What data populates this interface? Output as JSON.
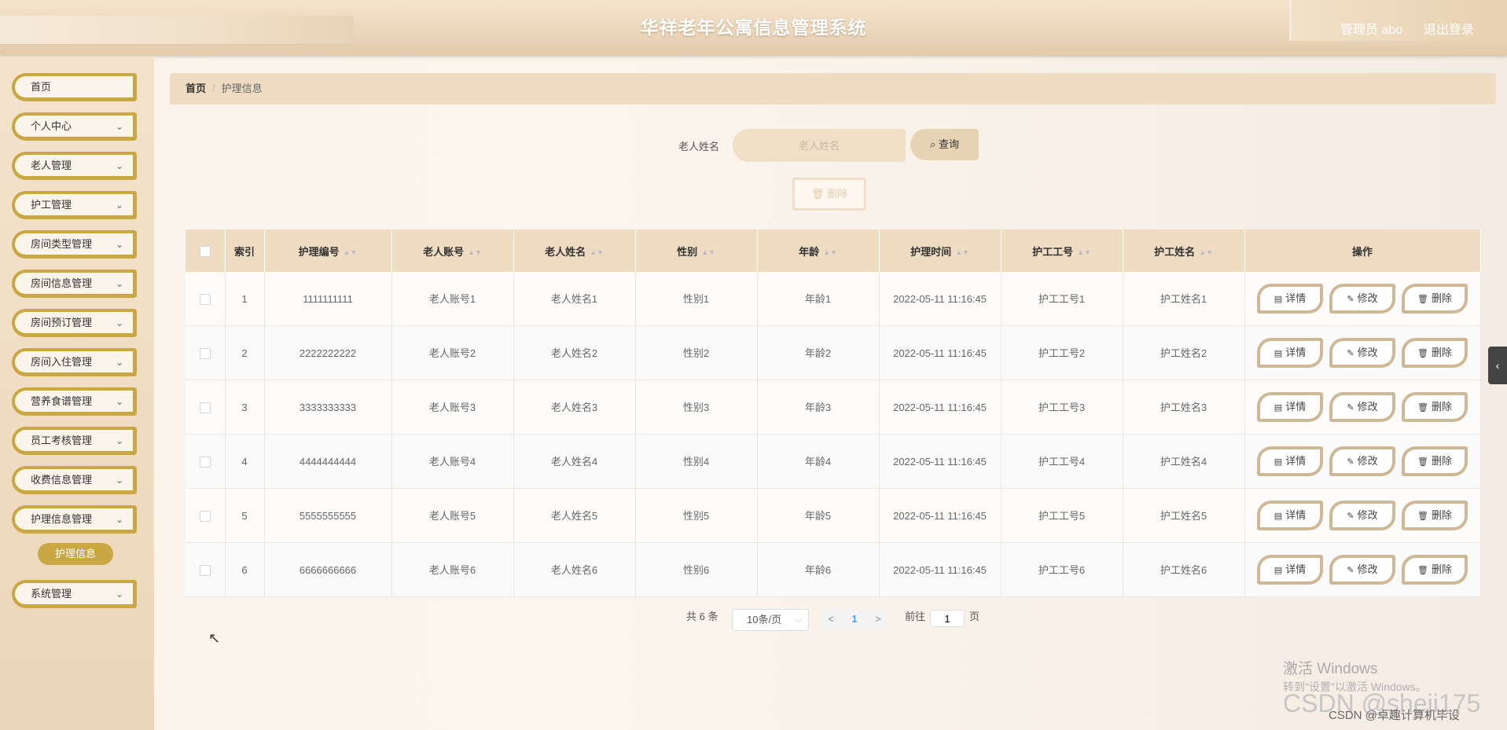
{
  "header": {
    "title": "华祥老年公寓信息管理系统",
    "user": "管理员 abo",
    "logout": "退出登录"
  },
  "sidebar": {
    "items": [
      {
        "label": "首页",
        "chevron": ""
      },
      {
        "label": "个人中心",
        "chevron": "⌄"
      },
      {
        "label": "老人管理",
        "chevron": "⌄"
      },
      {
        "label": "护工管理",
        "chevron": "⌄"
      },
      {
        "label": "房间类型管理",
        "chevron": "⌄"
      },
      {
        "label": "房间信息管理",
        "chevron": "⌄"
      },
      {
        "label": "房间预订管理",
        "chevron": "⌄"
      },
      {
        "label": "房间入住管理",
        "chevron": "⌄"
      },
      {
        "label": "营养食谱管理",
        "chevron": "⌄"
      },
      {
        "label": "员工考核管理",
        "chevron": "⌄"
      },
      {
        "label": "收费信息管理",
        "chevron": "⌄"
      },
      {
        "label": "护理信息管理",
        "chevron": "⌄"
      },
      {
        "label": "系统管理",
        "chevron": "⌄"
      }
    ],
    "sub_active": "护理信息"
  },
  "breadcrumb": {
    "home": "首页",
    "sep": "/",
    "current": "护理信息"
  },
  "search": {
    "label": "老人姓名",
    "placeholder": "老人姓名",
    "button": "查询",
    "button_icon": "⌕"
  },
  "batch_delete": {
    "label": "删除",
    "icon": "🗑"
  },
  "table": {
    "headers": {
      "index": "索引",
      "code": "护理编号",
      "account": "老人账号",
      "name": "老人姓名",
      "gender": "性别",
      "age": "年龄",
      "time": "护理时间",
      "worker_id": "护工工号",
      "worker_name": "护工姓名",
      "ops": "操作"
    },
    "sort_icon": "▲▼",
    "ops": {
      "detail": "详情",
      "edit": "修改",
      "delete": "删除",
      "detail_icon": "▤",
      "edit_icon": "✎",
      "delete_icon": "🗑"
    },
    "rows": [
      {
        "index": "1",
        "code": "1111111111",
        "account": "老人账号1",
        "name": "老人姓名1",
        "gender": "性别1",
        "age": "年龄1",
        "time": "2022-05-11 11:16:45",
        "worker_id": "护工工号1",
        "worker_name": "护工姓名1"
      },
      {
        "index": "2",
        "code": "2222222222",
        "account": "老人账号2",
        "name": "老人姓名2",
        "gender": "性别2",
        "age": "年龄2",
        "time": "2022-05-11 11:16:45",
        "worker_id": "护工工号2",
        "worker_name": "护工姓名2"
      },
      {
        "index": "3",
        "code": "3333333333",
        "account": "老人账号3",
        "name": "老人姓名3",
        "gender": "性别3",
        "age": "年龄3",
        "time": "2022-05-11 11:16:45",
        "worker_id": "护工工号3",
        "worker_name": "护工姓名3"
      },
      {
        "index": "4",
        "code": "4444444444",
        "account": "老人账号4",
        "name": "老人姓名4",
        "gender": "性别4",
        "age": "年龄4",
        "time": "2022-05-11 11:16:45",
        "worker_id": "护工工号4",
        "worker_name": "护工姓名4"
      },
      {
        "index": "5",
        "code": "5555555555",
        "account": "老人账号5",
        "name": "老人姓名5",
        "gender": "性别5",
        "age": "年龄5",
        "time": "2022-05-11 11:16:45",
        "worker_id": "护工工号5",
        "worker_name": "护工姓名5"
      },
      {
        "index": "6",
        "code": "6666666666",
        "account": "老人账号6",
        "name": "老人姓名6",
        "gender": "性别6",
        "age": "年龄6",
        "time": "2022-05-11 11:16:45",
        "worker_id": "护工工号6",
        "worker_name": "护工姓名6"
      }
    ]
  },
  "pagination": {
    "total": "共 6 条",
    "page_size": "10条/页",
    "prev": "<",
    "current": "1",
    "next": ">",
    "goto_prefix": "前往",
    "goto_value": "1",
    "goto_suffix": "页"
  },
  "watermark": {
    "line1": "激活 Windows",
    "line2": "转到\"设置\"以激活 Windows。",
    "line3": "CSDN @sheji175",
    "line4": "CSDN @卓趣计算机毕设"
  },
  "colors": {
    "accent": "#c9a743",
    "header_bg": "#ecd7bc",
    "table_head": "#efdcc2"
  }
}
